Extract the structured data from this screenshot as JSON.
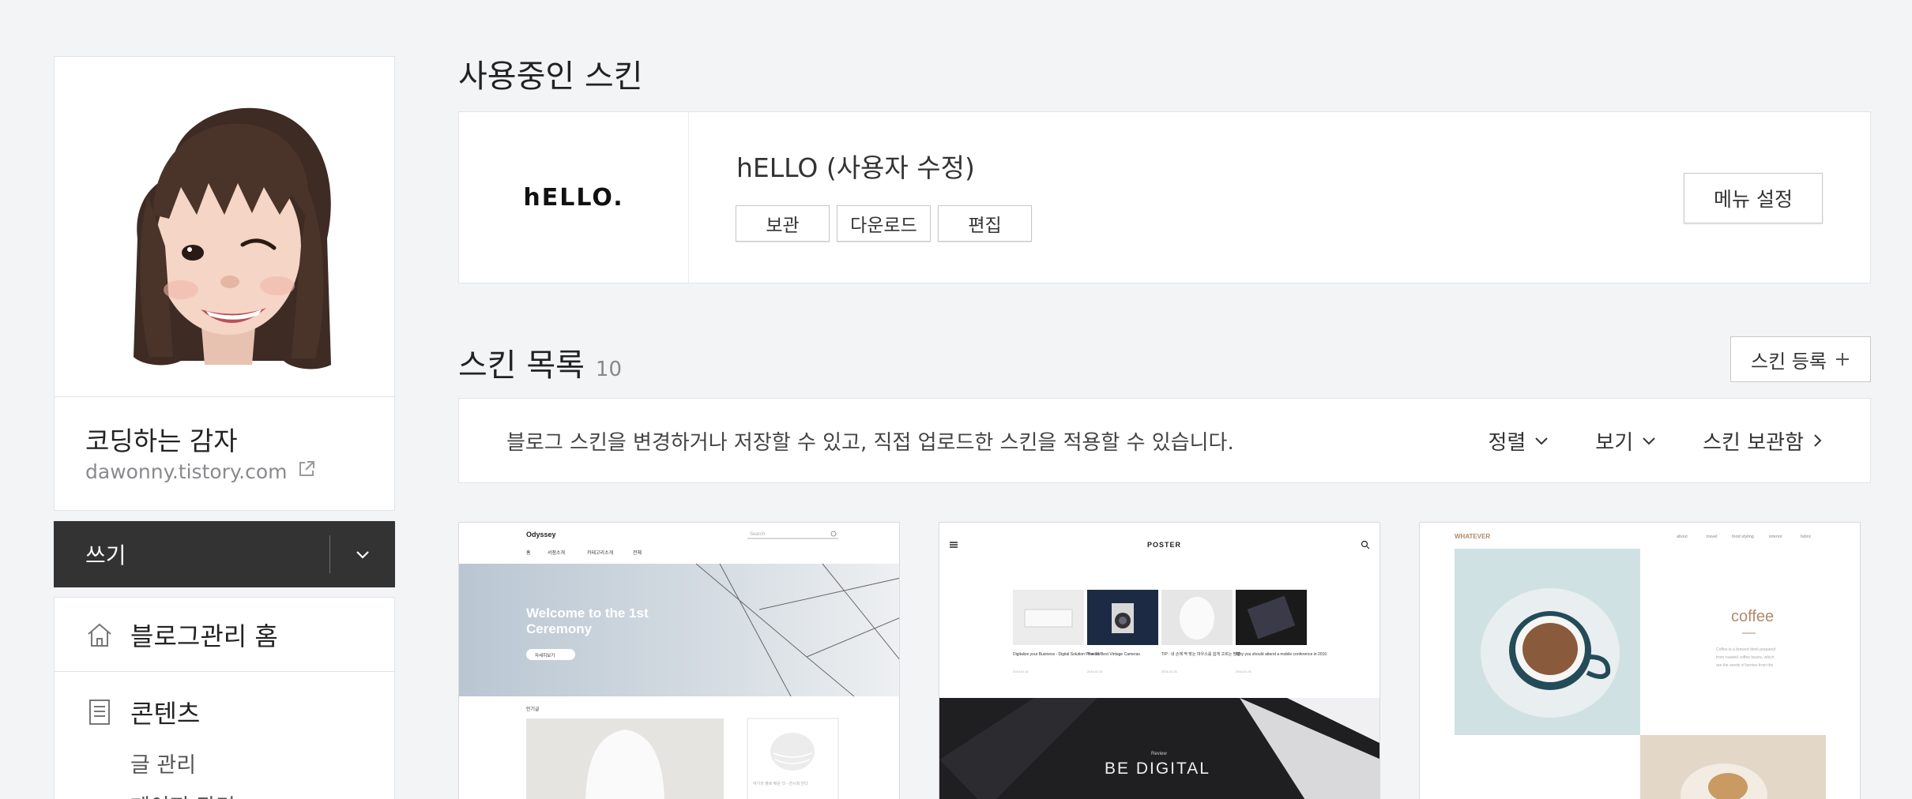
{
  "sidebar": {
    "blog_name": "코딩하는 감자",
    "blog_url": "dawonny.tistory.com",
    "write_label": "쓰기",
    "menu": {
      "home": "블로그관리 홈",
      "content": "콘텐츠",
      "content_items": [
        "글 관리",
        "페이지 관리"
      ]
    }
  },
  "current_skin": {
    "section_title": "사용중인 스킨",
    "logo_text": "hELLO.",
    "name": "hELLO (사용자 수정)",
    "buttons": [
      "보관",
      "다운로드",
      "편집"
    ],
    "menu_setting": "메뉴 설정"
  },
  "skin_list": {
    "section_title": "스킨 목록",
    "count": "10",
    "register_label": "스킨 등록",
    "description": "블로그 스킨을 변경하거나 저장할 수 있고, 직접 업로드한 스킨을 적용할 수 있습니다.",
    "controls": [
      "정렬",
      "보기",
      "스킨 보관함"
    ],
    "thumbs": {
      "odyssey": {
        "brand": "Odyssey",
        "search": "Search",
        "nav": [
          "홈",
          "서점소개",
          "카테고리소개",
          "전체"
        ],
        "hero": [
          "Welcome to the 1st",
          "Ceremony"
        ],
        "hero_button": "자세히보기",
        "section_label": "인기글",
        "card_caption": "여기의 플로 배운 더 - 전시회 한다"
      },
      "poster": {
        "brand": "POSTER",
        "captions": [
          "Digitalize your Business - Digital Solution Provider",
          "The 16 Best Vintage Cameras",
          "TIP : 내 손에 딱 맞는 마우스를 쉽게 고르는 방법",
          "Why you should attend a mobile conference in 2016"
        ],
        "dates": [
          "2016.01.01",
          "2016.01.01",
          "2016.01.01",
          "2016.01.01"
        ],
        "hero_kicker": "Review",
        "hero_title": "BE DIGITAL"
      },
      "whatever": {
        "brand": "WHATEVER",
        "nav": [
          "about",
          "travel",
          "food styling",
          "interior",
          "fabric"
        ],
        "feature_title": "coffee",
        "feature_text": [
          "Coffee is a brewed drink prepared",
          "from roasted coffee beans, which",
          "are the seeds of berries from the"
        ]
      }
    }
  },
  "colors": {
    "page_bg": "#f3f4f6",
    "write_bar_bg": "#333333",
    "card_border": "#e2e3e6",
    "whatever_brand": "#b08a6a"
  }
}
